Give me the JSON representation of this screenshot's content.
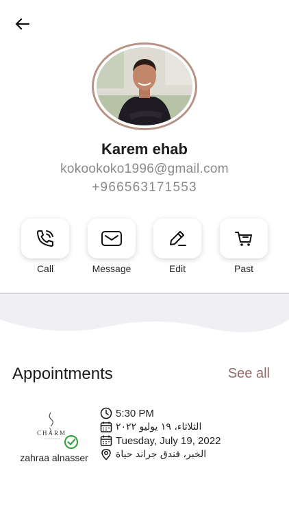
{
  "header": {
    "back_icon": "arrow-left-icon"
  },
  "profile": {
    "name": "Karem ehab",
    "email": "kokookoko1996@gmail.com",
    "phone": "+966563171553"
  },
  "actions": [
    {
      "label": "Call",
      "icon": "phone-icon"
    },
    {
      "label": "Message",
      "icon": "mail-icon"
    },
    {
      "label": "Edit",
      "icon": "edit-pencil-icon"
    },
    {
      "label": "Past",
      "icon": "cart-icon"
    }
  ],
  "appointments": {
    "title": "Appointments",
    "see_all": "See all",
    "items": [
      {
        "vendor_name": "zahraa alnasser",
        "logo_text": "CHARM",
        "time": "5:30 PM",
        "date_arabic": "الثلاثاء، ١٩ يوليو ٢٠٢٢",
        "date_english": "Tuesday, July 19, 2022",
        "location": "الخبر، فندق جراند حياة"
      }
    ]
  },
  "colors": {
    "accent": "#8e6b6b",
    "avatar_border": "#b79386",
    "verified": "#3aa047",
    "muted_text": "#8a8a8a"
  }
}
